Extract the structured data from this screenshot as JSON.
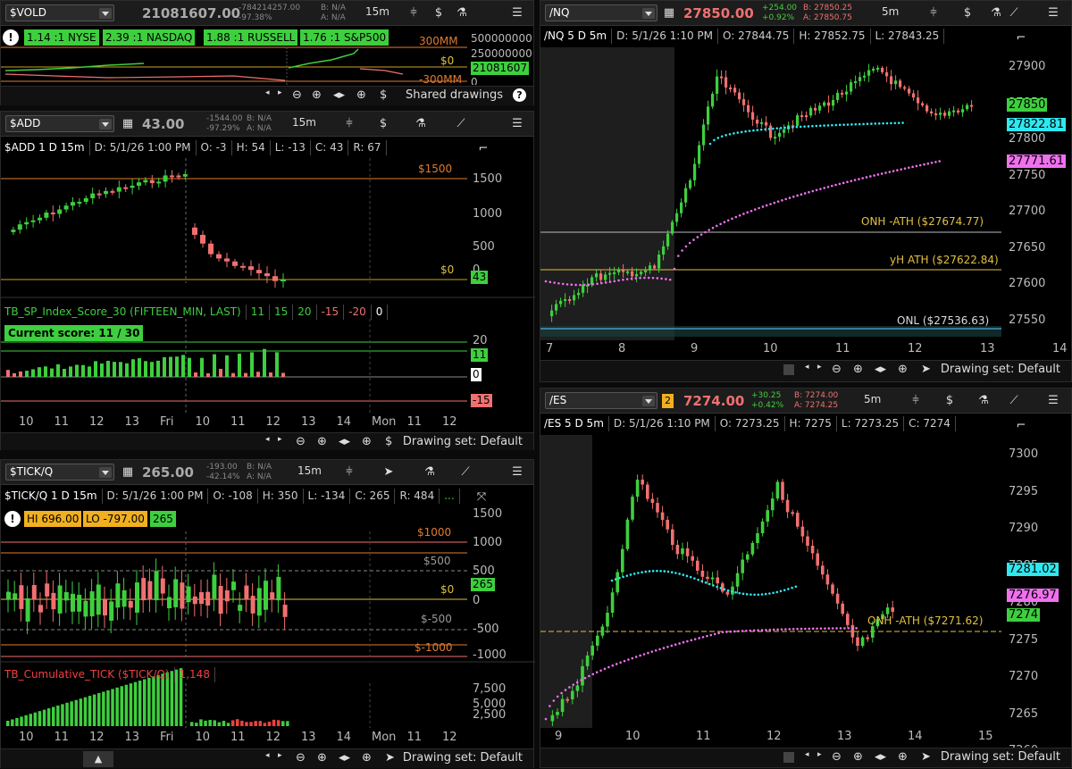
{
  "vold": {
    "symbol": "$VOLD",
    "price": "21081607.00",
    "chg1": "-784214257.00",
    "chg2": "-97.38%",
    "bid": "B: N/A",
    "ask": "A: N/A",
    "tf": "15m",
    "ratios": [
      "1.14 :1 NYSE",
      "2.39 :1 NASDAQ",
      "1.88 :1 RUSSELL",
      "1.76 :1 S&P500"
    ],
    "lbl_300": "300MM",
    "lbl_0": "$0",
    "lbl_neg": "-300MM",
    "ax": [
      "500000000",
      "250000000",
      "0"
    ],
    "last": "21081607",
    "shared": "Shared drawings"
  },
  "add": {
    "symbol": "$ADD",
    "price": "43.00",
    "chg1": "-1544.00",
    "chg2": "-97.29%",
    "bid": "B: N/A",
    "ask": "A: N/A",
    "tf": "15m",
    "title": [
      "$ADD 1 D 15m",
      "D: 5/1/26 1:00 PM",
      "O: -3",
      "H: 54",
      "L: -13",
      "C: 43",
      "R: 67"
    ],
    "lbl_1500": "$1500",
    "lbl_0": "$0",
    "ax": [
      "1500",
      "1000",
      "500",
      "0"
    ],
    "last": "43",
    "score_title": [
      "TB_SP_Index_Score_30 (FIFTEEN_MIN, LAST)",
      "11",
      "15",
      "20",
      "-15",
      "-20",
      "0"
    ],
    "current_score": "Current score: 11 / 30",
    "score_ax": [
      "20"
    ],
    "tag11": "11",
    "tag0": "0",
    "tagm15": "-15",
    "xticks": [
      "10",
      "11",
      "12",
      "13",
      "Fri",
      "10",
      "11",
      "12",
      "13",
      "14",
      "Mon",
      "11",
      "12"
    ],
    "drawset": "Drawing set: Default"
  },
  "tick": {
    "symbol": "$TICK/Q",
    "price": "265.00",
    "chg1": "-193.00",
    "chg2": "-42.14%",
    "bid": "B: N/A",
    "ask": "A: N/A",
    "tf": "15m",
    "title": [
      "$TICK/Q 1 D 15m",
      "D: 5/1/26 1:00 PM",
      "O: -108",
      "H: 350",
      "L: -134",
      "C: 265",
      "R: 484",
      "..."
    ],
    "hi": "HI 696.00",
    "lo": "LO -797.00",
    "lastbox": "265",
    "lbl_1000": "$1000",
    "lbl_500": "$500",
    "lbl_0": "$0",
    "lbl_m500": "$-500",
    "lbl_m1000": "$-1000",
    "ax": [
      "1500",
      "1000",
      "500",
      "0",
      "-500",
      "-1000"
    ],
    "last": "265",
    "cum_title": [
      "TB_Cumulative_TICK ($TICK/Q)",
      "1,148"
    ],
    "cum_ax": [
      "7,500",
      "5,000",
      "2,500"
    ],
    "xticks": [
      "10",
      "11",
      "12",
      "13",
      "Fri",
      "10",
      "11",
      "12",
      "13",
      "14",
      "Mon",
      "11",
      "12"
    ],
    "drawset": "Drawing set: Default"
  },
  "nq": {
    "symbol": "/NQ",
    "price": "27850.00",
    "chg1": "+254.00",
    "chg2": "+0.92%",
    "bid": "B: 27850.25",
    "ask": "A: 27850.75",
    "tf": "5m",
    "title": [
      "/NQ 5 D 5m",
      "D: 5/1/26 1:10 PM",
      "O: 27844.75",
      "H: 27852.75",
      "L: 27843.25"
    ],
    "ax": [
      "27900",
      "27850",
      "27800",
      "27750",
      "27700",
      "27650",
      "27600",
      "27550"
    ],
    "tag_last": "27850",
    "tag_cyan": "27822.81",
    "tag_mag": "27771.61",
    "onh": "ONH -ATH ($27674.77)",
    "yh": "yH ATH ($27622.84)",
    "onl": "ONL ($27536.63)",
    "xticks": [
      "7",
      "8",
      "9",
      "10",
      "11",
      "12",
      "13",
      "14"
    ],
    "drawset": "Drawing set: Default"
  },
  "es": {
    "symbol": "/ES",
    "badge": "2",
    "price": "7274.00",
    "chg1": "+30.25",
    "chg2": "+0.42%",
    "bid": "B: 7274.00",
    "ask": "A: 7274.25",
    "tf": "5m",
    "title": [
      "/ES 5 D 5m",
      "D: 5/1/26 1:10 PM",
      "O: 7273.25",
      "H: 7275",
      "L: 7273.25",
      "C: 7274"
    ],
    "ax": [
      "7300",
      "7295",
      "7290",
      "7285",
      "7280",
      "7275",
      "7270",
      "7265",
      "7260"
    ],
    "tag_cyan": "7281.02",
    "tag_mag": "7276.97",
    "tag_last": "7274",
    "onh": "ONH -ATH ($7271.62)",
    "xticks": [
      "9",
      "10",
      "11",
      "12",
      "13",
      "14",
      "15"
    ],
    "drawset": "Drawing set: Default"
  },
  "colors": {
    "up": "#3ecf3e",
    "down": "#f07070",
    "orange": "#e07b2e",
    "gold": "#e0c040",
    "cyan": "#2ee8f0",
    "magenta": "#f070f0"
  }
}
